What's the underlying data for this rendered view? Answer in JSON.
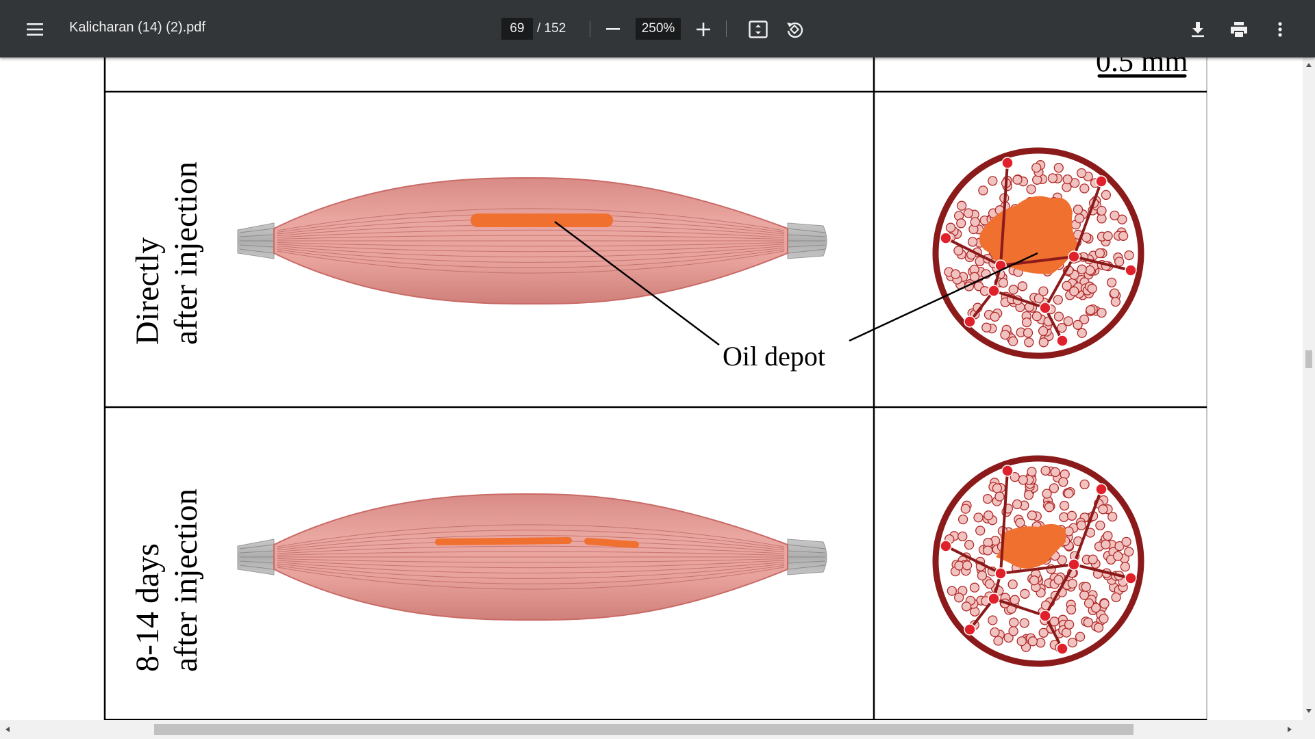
{
  "toolbar": {
    "menu_icon": "hamburger-menu-icon",
    "title": "Kalicharan (14) (2).pdf",
    "page_current": "69",
    "page_total": "/ 152",
    "zoom": "250%",
    "icons": [
      "zoom-out-icon",
      "zoom-in-icon",
      "fit-to-page-icon",
      "rotate-icon",
      "download-icon",
      "print-icon",
      "more-options-icon"
    ]
  },
  "figure": {
    "scale_bar_label": "0.5 mm",
    "rows": [
      {
        "label_line1": "Directly",
        "label_line2": "after injection"
      },
      {
        "label_line1": "8-14 days",
        "label_line2": "after injection"
      }
    ],
    "callout": "Oil depot",
    "colors": {
      "muscle": "#e8a09b",
      "muscle_dark": "#c96a66",
      "tendon": "#b5b5b5",
      "oil": "#f07030",
      "fascicle_border": "#8b1a1a",
      "node_red": "#e0202a"
    }
  },
  "scrollbars": {
    "vertical_thumb_fraction": 0.45,
    "horizontal_thumb_fraction": 0.74
  }
}
